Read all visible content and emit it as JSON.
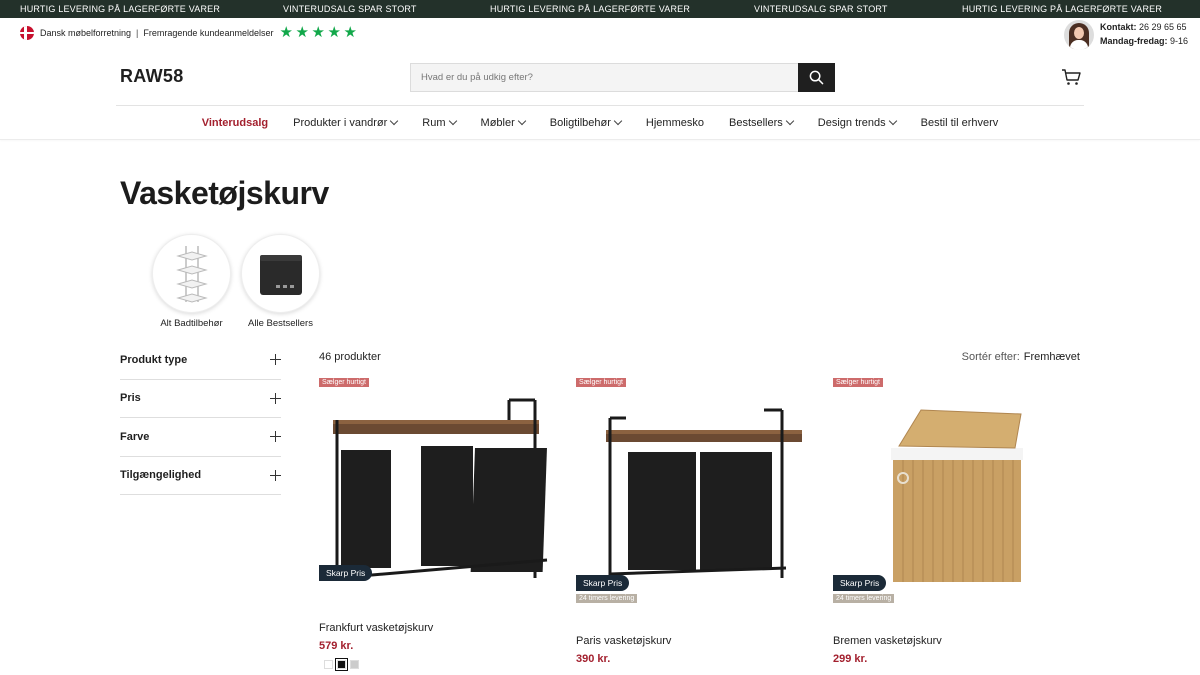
{
  "announcements": [
    "HURTIG LEVERING PÅ LAGERFØRTE VARER",
    "VINTERUDSALG SPAR STORT",
    "HURTIG LEVERING PÅ LAGERFØRTE VARER",
    "VINTERUDSALG SPAR STORT",
    "HURTIG LEVERING PÅ LAGERFØRTE VARER"
  ],
  "trust": {
    "store": "Dansk møbelforretning",
    "separator": "|",
    "reviews": "Fremragende kundeanmeldelser",
    "stars": 5,
    "star_color": "#12a84a"
  },
  "contact": {
    "label": "Kontakt:",
    "phone": "26 29 65 65",
    "hours_label": "Mandag-fredag:",
    "hours": "9-16"
  },
  "header": {
    "logo": "RAW58",
    "search_placeholder": "Hvad er du på udkig efter?"
  },
  "nav": [
    {
      "label": "Vinterudsalg",
      "dropdown": false,
      "highlight": true
    },
    {
      "label": "Produkter i vandrør",
      "dropdown": true
    },
    {
      "label": "Rum",
      "dropdown": true
    },
    {
      "label": "Møbler",
      "dropdown": true
    },
    {
      "label": "Boligtilbehør",
      "dropdown": true
    },
    {
      "label": "Hjemmesko",
      "dropdown": false
    },
    {
      "label": "Bestsellers",
      "dropdown": true
    },
    {
      "label": "Design trends",
      "dropdown": true
    },
    {
      "label": "Bestil til erhverv",
      "dropdown": false
    }
  ],
  "page_title": "Vasketøjskurv",
  "categories": [
    {
      "label": "Alt Badtilbehør",
      "icon": "shelf-rack-icon"
    },
    {
      "label": "Alle Bestsellers",
      "icon": "trash-bin-icon"
    }
  ],
  "filters": [
    "Produkt type",
    "Pris",
    "Farve",
    "Tilgængelighed"
  ],
  "product_count": "46 produkter",
  "sort": {
    "label": "Sortér efter:",
    "value": "Fremhævet"
  },
  "products": [
    {
      "badge": "Sælger hurtigt",
      "price_badge": "Skarp Pris",
      "shipping_badge": "",
      "name": "Frankfurt vasketøjskurv",
      "price": "579 kr."
    },
    {
      "badge": "Sælger hurtigt",
      "price_badge": "Skarp Pris",
      "shipping_badge": "24 timers levering",
      "name": "Paris vasketøjskurv",
      "price": "390 kr."
    },
    {
      "badge": "Sælger hurtigt",
      "price_badge": "Skarp Pris",
      "shipping_badge": "24 timers levering",
      "name": "Bremen vasketøjskurv",
      "price": "299 kr."
    }
  ],
  "colors": {
    "sale_red": "#a3202e",
    "topbar": "#23312a",
    "badge_fast": "#cd6b6b",
    "badge_price": "#1b2a38",
    "badge_ship": "#b8b0a4"
  }
}
